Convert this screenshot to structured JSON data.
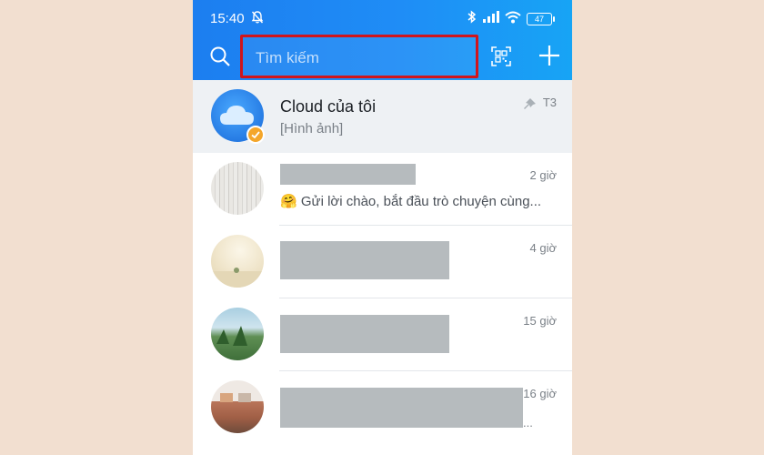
{
  "status": {
    "time": "15:40",
    "battery": "47"
  },
  "search": {
    "placeholder": "Tìm kiếm"
  },
  "chats": [
    {
      "name": "Cloud của tôi",
      "preview": "[Hình ảnh]",
      "time": "T3",
      "pinned": true
    },
    {
      "name": "",
      "preview": "Gửi lời chào, bắt đầu trò chuyện cùng...",
      "preview_emoji": "🤗",
      "time": "2 giờ"
    },
    {
      "name": "",
      "preview": "",
      "time": "4 giờ"
    },
    {
      "name": "",
      "preview": "",
      "time": "15 giờ"
    },
    {
      "name": "",
      "preview": "...",
      "time": "16 giờ"
    }
  ],
  "colors": {
    "header": "#1f8df6",
    "search_highlight": "#d0151c",
    "badge": "#f4a62a",
    "background": "#f2dfd0"
  }
}
